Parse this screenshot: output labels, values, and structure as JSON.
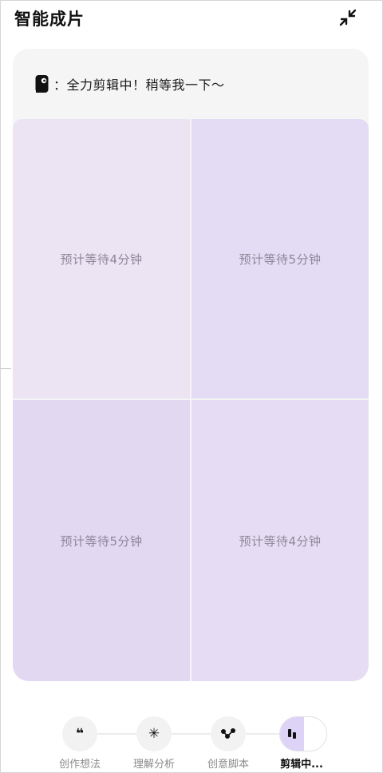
{
  "header": {
    "title": "智能成片",
    "collapse_icon": "collapse-arrows-icon"
  },
  "status": {
    "icon": "bot-avatar-icon",
    "text": "：全力剪辑中！稍等我一下～"
  },
  "grid": {
    "cells": [
      {
        "label": "预计等待4分钟",
        "color": "#ece3f3"
      },
      {
        "label": "预计等待5分钟",
        "color": "#e4dbf4"
      },
      {
        "label": "预计等待5分钟",
        "color": "#e2d8f2"
      },
      {
        "label": "预计等待4分钟",
        "color": "#e6ddf4"
      }
    ]
  },
  "steps": {
    "items": [
      {
        "label": "创作想法",
        "icon": "quote-icon",
        "glyph": "❝",
        "active": false
      },
      {
        "label": "理解分析",
        "icon": "sparkle-icon",
        "glyph": "✳",
        "active": false
      },
      {
        "label": "创意脚本",
        "icon": "nodes-icon",
        "glyph": "",
        "active": false
      },
      {
        "label": "剪辑中...",
        "icon": "clips-icon",
        "glyph": "",
        "active": true
      }
    ]
  },
  "colors": {
    "accent": "#dcd3f7",
    "card_bg": "#f5f5f5"
  }
}
